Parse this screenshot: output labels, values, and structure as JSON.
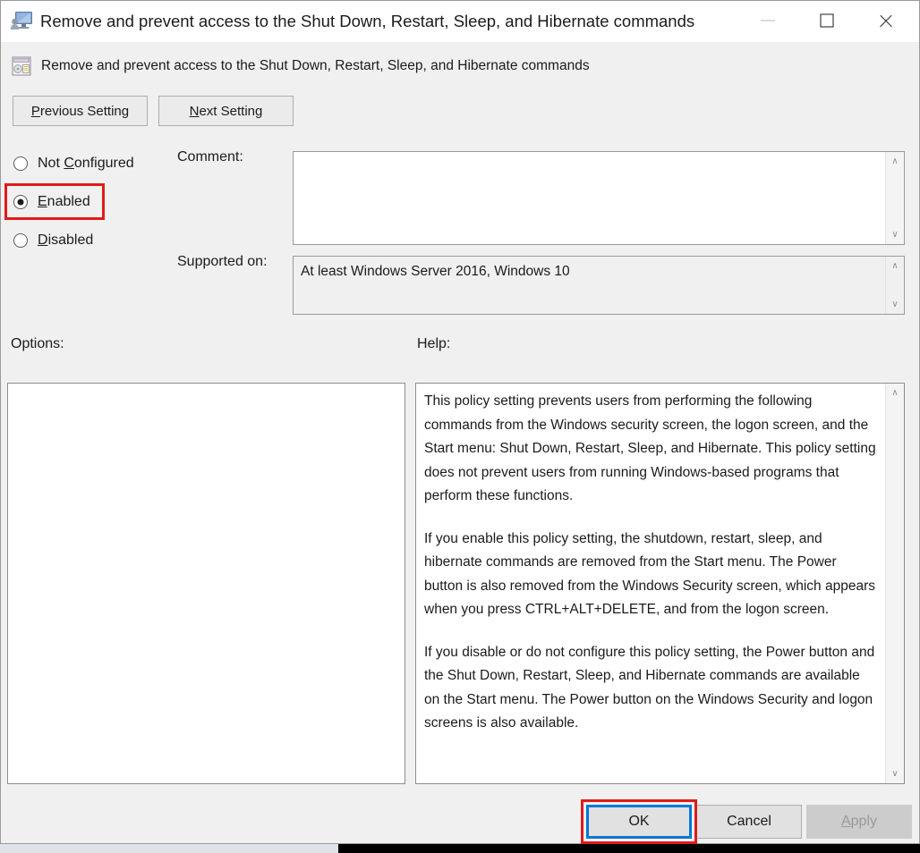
{
  "window": {
    "title": "Remove and prevent access to the Shut Down, Restart, Sleep, and Hibernate commands",
    "icon": "user-configuration-monitor-icon",
    "controls": {
      "minimize": "—",
      "maximize": "□",
      "close": "✕"
    }
  },
  "header": {
    "policy_name": "Remove and prevent access to the Shut Down, Restart, Sleep, and Hibernate commands",
    "policy_icon": "group-policy-setting-icon",
    "previous_setting": "Previous Setting",
    "previous_setting_accel": "P",
    "previous_setting_rest": "revious Setting",
    "next_setting": "Next Setting",
    "next_setting_accel": "N",
    "next_setting_rest": "ext Setting"
  },
  "state_options": [
    {
      "id": "not-configured",
      "accel": "Not ",
      "accel_char": "C",
      "rest": "onfigured",
      "label": "Not Configured",
      "selected": false
    },
    {
      "id": "enabled",
      "accel": "",
      "accel_char": "E",
      "rest": "nabled",
      "label": "Enabled",
      "selected": true
    },
    {
      "id": "disabled",
      "accel": "",
      "accel_char": "D",
      "rest": "isabled",
      "label": "Disabled",
      "selected": false
    }
  ],
  "comment": {
    "label": "Comment:",
    "value": "",
    "placeholder": ""
  },
  "supported_on": {
    "label": "Supported on:",
    "value": "At least Windows Server 2016, Windows 10"
  },
  "options": {
    "label": "Options:",
    "content": ""
  },
  "help": {
    "label": "Help:",
    "paragraphs": [
      "This policy setting prevents users from performing the following commands from the Windows security screen, the logon screen, and the Start menu: Shut Down, Restart, Sleep, and Hibernate. This policy setting does not prevent users from running Windows-based programs that perform these functions.",
      "If you enable this policy setting, the shutdown, restart, sleep, and hibernate commands are removed from the Start menu. The Power button is also removed from the Windows Security screen, which appears when you press CTRL+ALT+DELETE, and from the logon screen.",
      "If you disable or do not configure this policy setting, the Power button and the Shut Down, Restart, Sleep, and Hibernate commands are available on the Start menu. The Power button on the Windows Security and logon screens is also available."
    ]
  },
  "buttons": {
    "ok": "OK",
    "cancel": "Cancel",
    "apply_accel": "A",
    "apply_rest": "pply",
    "apply": "Apply",
    "apply_disabled": true
  },
  "scrollbar": {
    "up": "∧",
    "down": "∨"
  },
  "annotations": {
    "highlight_color": "#e01b1b",
    "focus_color": "#0078d7"
  }
}
